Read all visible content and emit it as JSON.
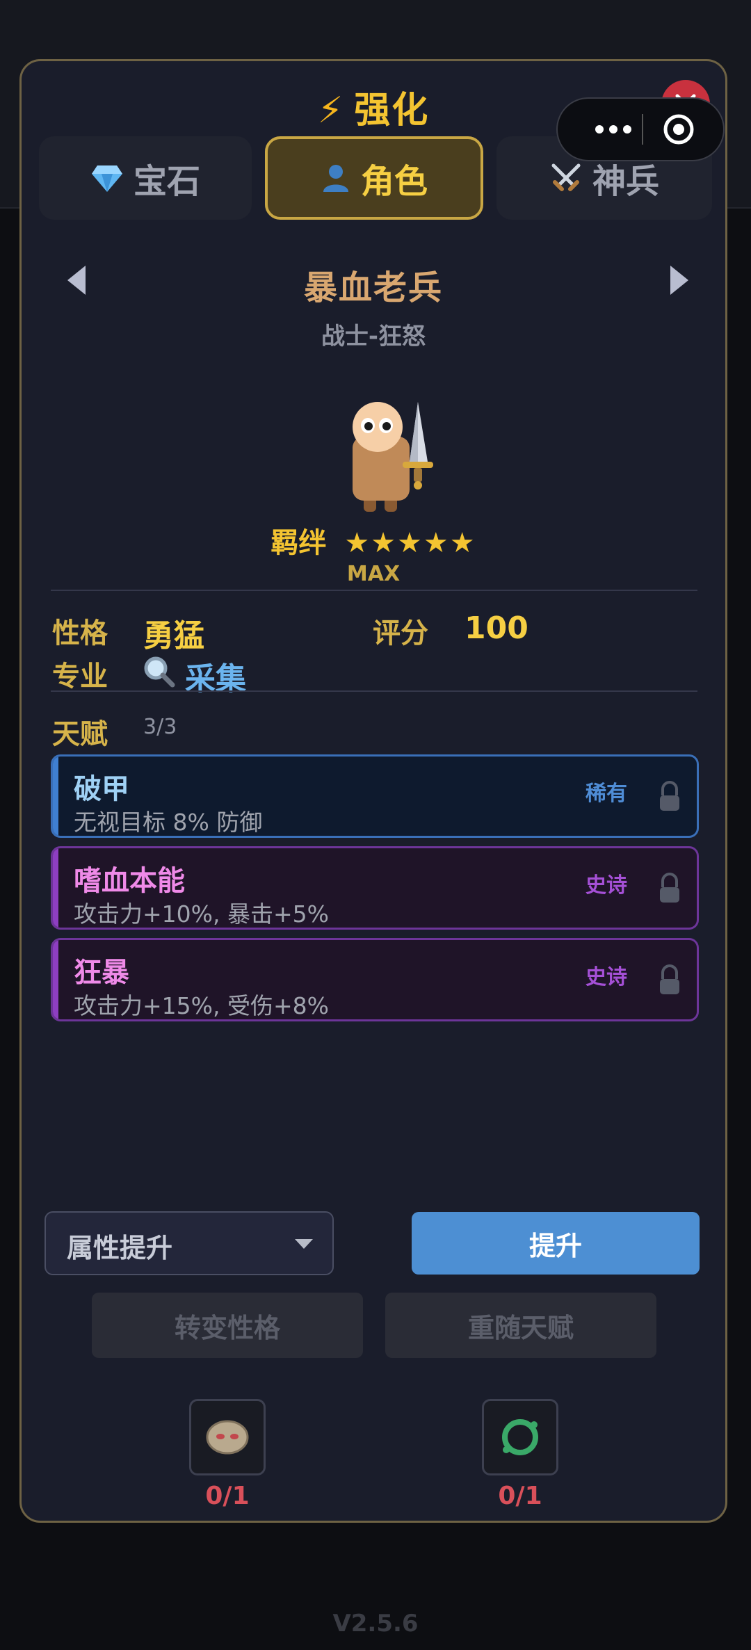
{
  "header": {
    "title": "强化",
    "title_icon": "lightning-icon"
  },
  "tabs": [
    {
      "label": "宝石",
      "icon": "gem-icon",
      "active": false
    },
    {
      "label": "角色",
      "icon": "person-icon",
      "active": true
    },
    {
      "label": "神兵",
      "icon": "crossed-swords-icon",
      "active": false
    }
  ],
  "character": {
    "name": "暴血老兵",
    "class": "战士-狂怒",
    "bond_label": "羁绊",
    "stars": "★★★★★",
    "star_count": 5,
    "max_label": "MAX"
  },
  "stats": {
    "personality_label": "性格",
    "personality_value": "勇猛",
    "score_label": "评分",
    "score_value": "100",
    "specialty_label": "专业",
    "specialty_value": "采集",
    "specialty_icon": "magnifier-icon"
  },
  "talents": {
    "label": "天赋",
    "count": "3/3",
    "items": [
      {
        "name": "破甲",
        "desc": "无视目标 8% 防御",
        "rarity": "稀有"
      },
      {
        "name": "嗜血本能",
        "desc": "攻击力+10%, 暴击+5%",
        "rarity": "史诗"
      },
      {
        "name": "狂暴",
        "desc": "攻击力+15%, 受伤+8%",
        "rarity": "史诗"
      }
    ]
  },
  "actions": {
    "select_value": "属性提升",
    "upgrade_label": "提升",
    "change_personality_label": "转变性格",
    "reroll_talent_label": "重随天赋"
  },
  "materials": [
    {
      "icon": "red-eyed-stone-icon",
      "count": "0/1"
    },
    {
      "icon": "green-ring-icon",
      "count": "0/1"
    }
  ],
  "footer": {
    "version": "V2.5.6"
  },
  "colors": {
    "panel_bg": "#1a1d2b",
    "gold": "#f4c431",
    "rare_blue": "#4f8dd6",
    "epic_purple": "#a550d6",
    "primary_button": "#4d8fd3",
    "close_red": "#c9313e"
  }
}
